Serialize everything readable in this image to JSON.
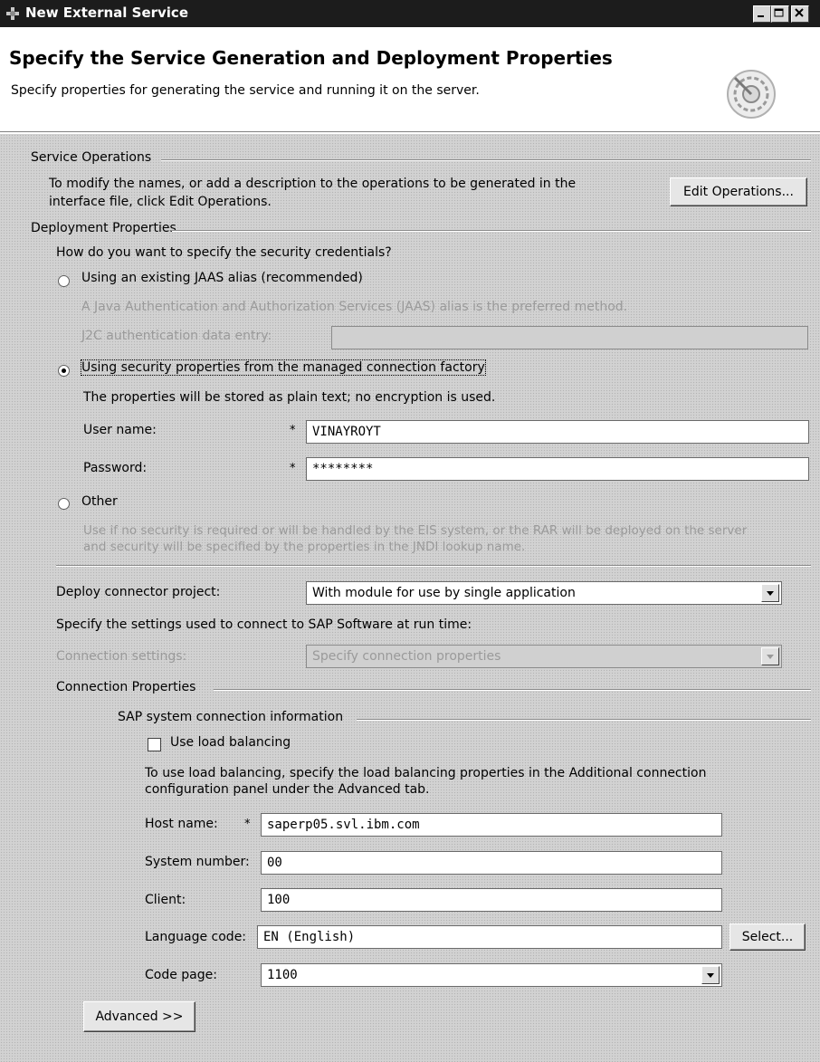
{
  "window": {
    "title": "New External Service"
  },
  "header": {
    "title": "Specify the Service Generation and Deployment Properties",
    "subtitle": "Specify properties for generating the service and running it on the server."
  },
  "service_operations": {
    "group_label": "Service Operations",
    "desc_line1": "To modify the names, or add a description to the operations to be generated in the",
    "desc_line2": "interface file, click Edit Operations.",
    "edit_button": "Edit Operations..."
  },
  "deployment": {
    "group_label": "Deployment Properties",
    "question": "How do you want to specify the security credentials?",
    "jaas": {
      "label": "Using an existing JAAS alias (recommended)",
      "desc": "A Java Authentication and Authorization Services (JAAS) alias is the preferred method.",
      "entry_label": "J2C authentication data entry:",
      "entry_value": "",
      "selected": false
    },
    "mcf": {
      "label": "Using security properties from the managed connection factory",
      "note": "The properties will be stored as plain text; no encryption is used.",
      "username_label": "User name:",
      "username_value": "VINAYROYT",
      "password_label": "Password:",
      "password_value": "********",
      "required_mark": "*",
      "selected": true
    },
    "other": {
      "label": "Other",
      "desc_line1": "Use if no security is required or will be handled by the EIS system, or the RAR will be deployed on the server",
      "desc_line2": "and security will be specified by the properties in the JNDI lookup name.",
      "selected": false
    },
    "deploy_label": "Deploy connector project:",
    "deploy_value": "With module for use by single application",
    "settings_question": "Specify the settings used to connect to SAP Software at run time:",
    "connection_settings_label": "Connection settings:",
    "connection_settings_value": "Specify connection properties"
  },
  "connection_properties": {
    "group_label": "Connection Properties",
    "sap_group_label": "SAP system connection information",
    "load_balancing_label": "Use load balancing",
    "load_balancing_checked": false,
    "lb_desc_line1": "To use load balancing, specify the load balancing properties in the Additional connection",
    "lb_desc_line2": "configuration panel under the Advanced tab.",
    "host_label": "Host name:",
    "host_value": "saperp05.svl.ibm.com",
    "host_required": "*",
    "sysnum_label": "System number:",
    "sysnum_value": "00",
    "client_label": "Client:",
    "client_value": "100",
    "lang_label": "Language code:",
    "lang_value": "EN (English)",
    "select_button": "Select...",
    "codepage_label": "Code page:",
    "codepage_value": "1100",
    "advanced_button": "Advanced >>"
  }
}
